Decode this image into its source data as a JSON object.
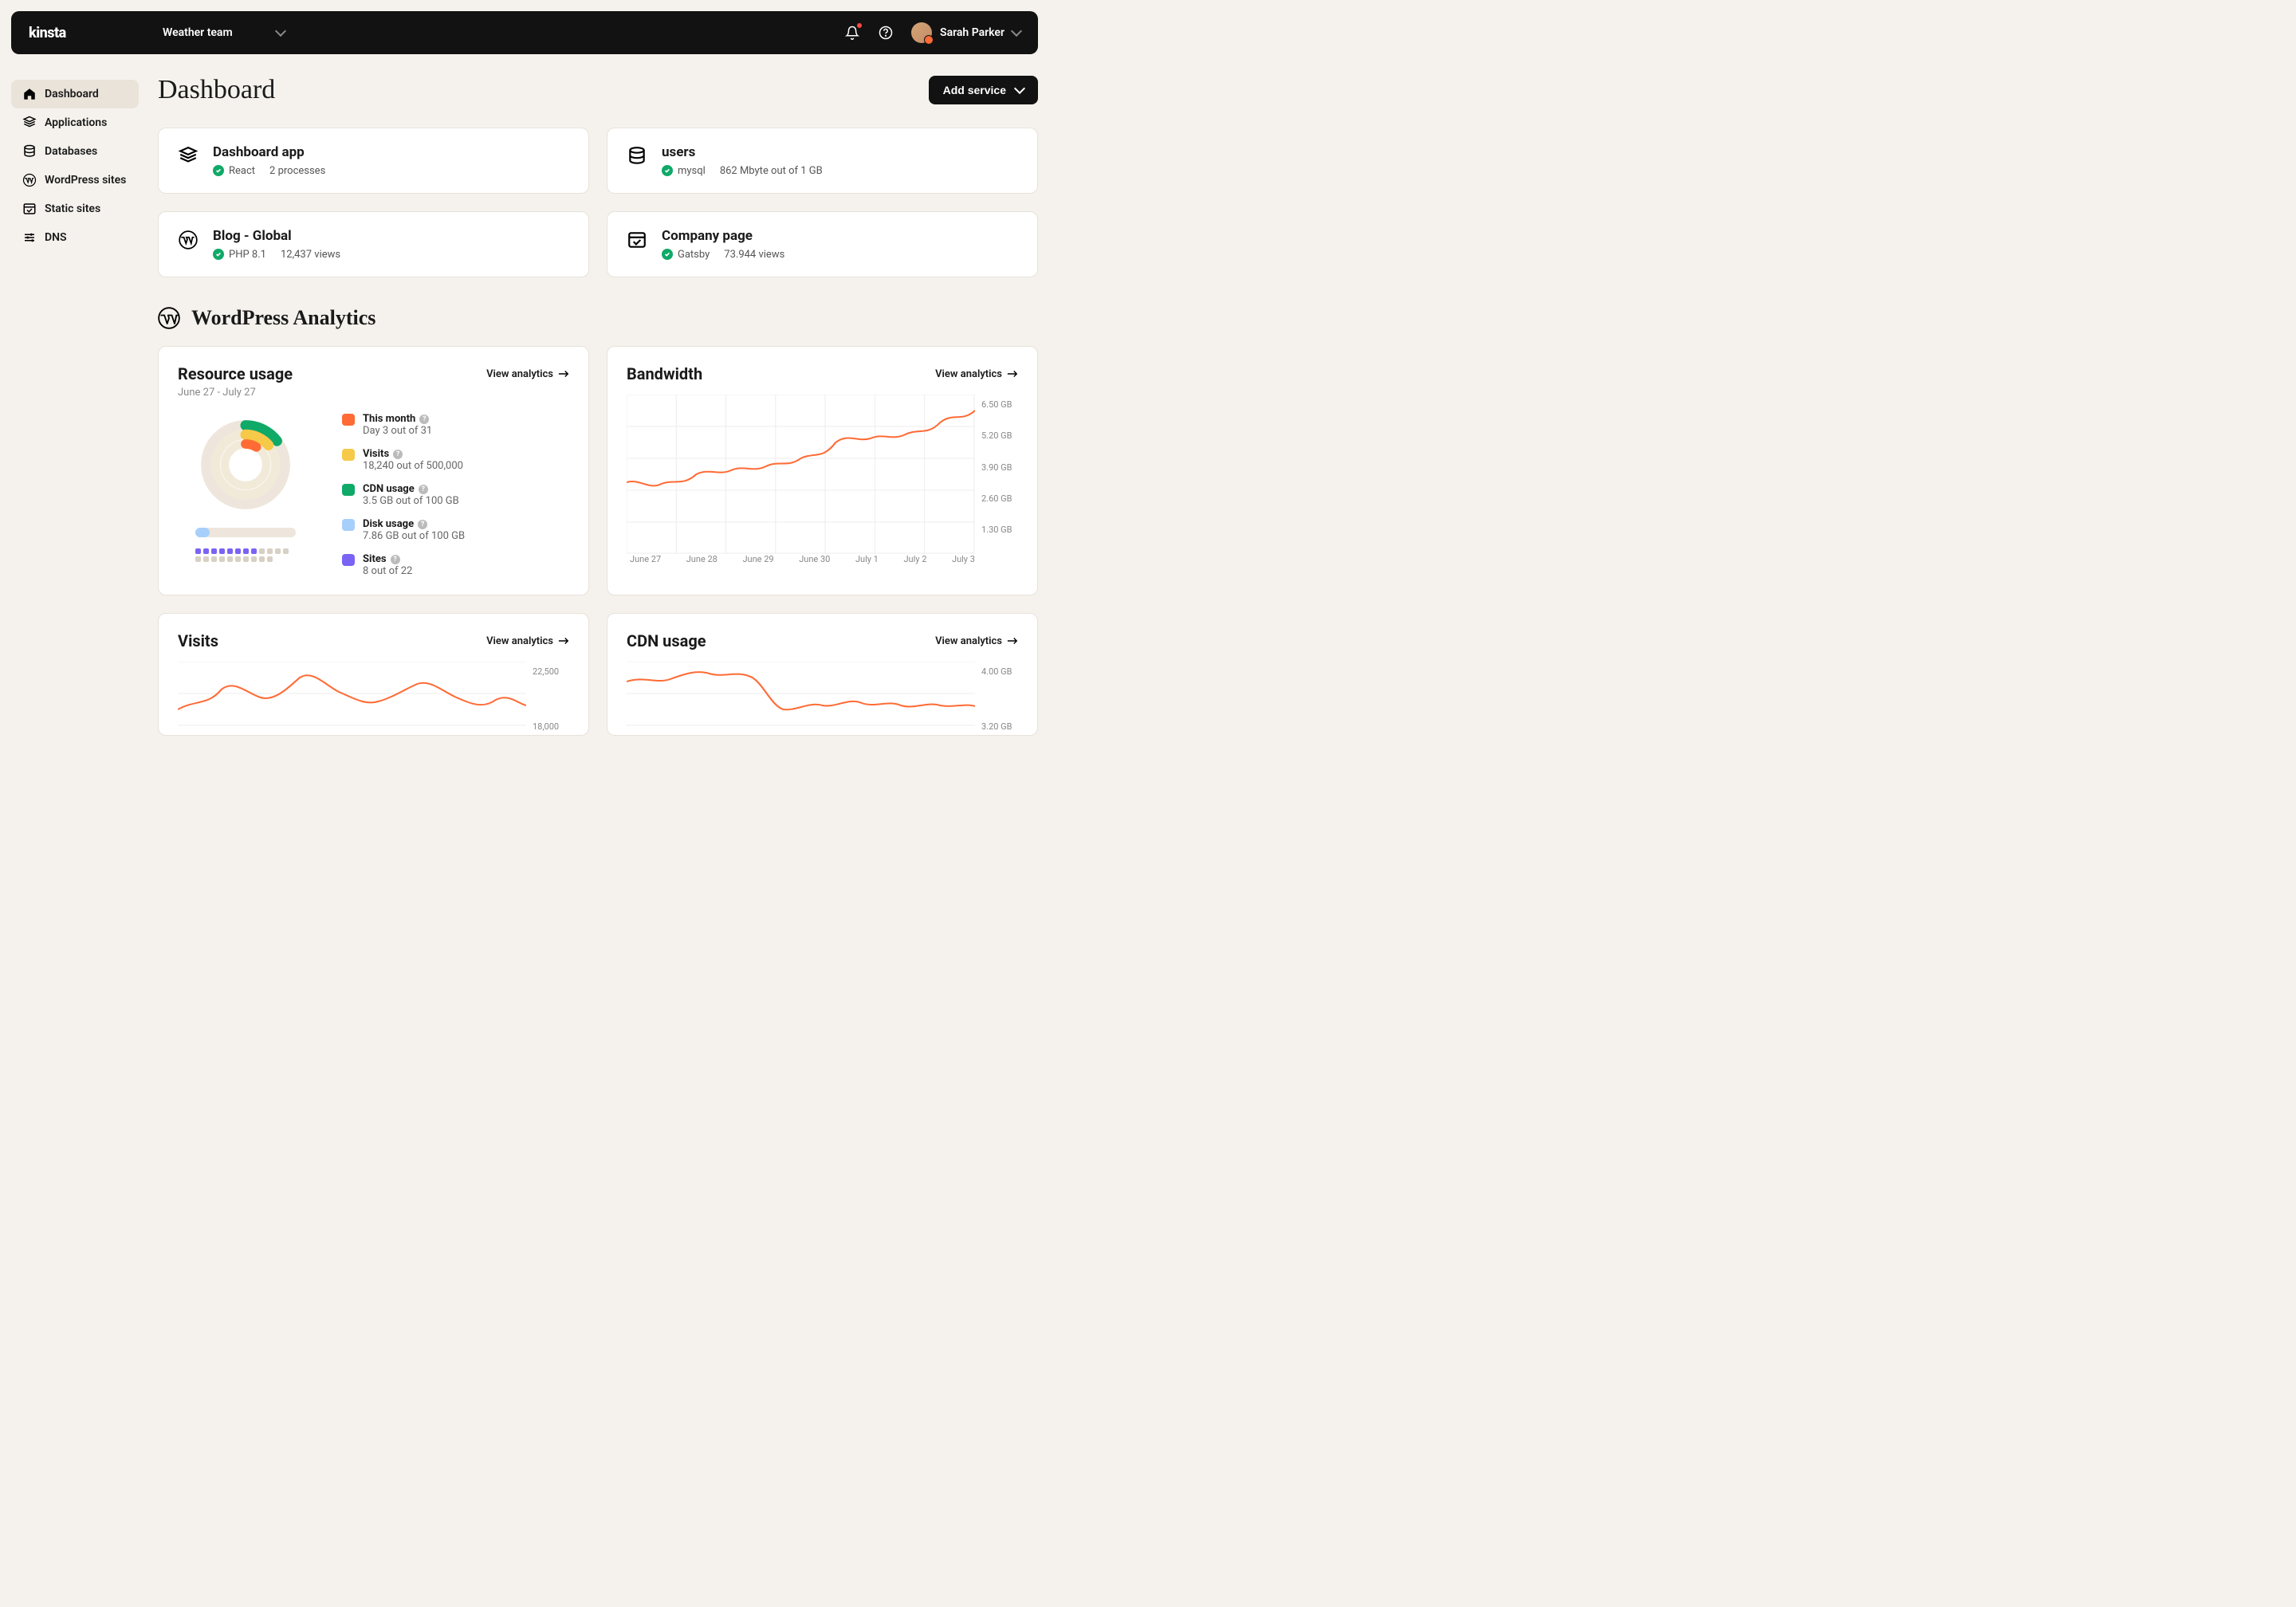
{
  "brand": "kinsta",
  "team_selector": "Weather team",
  "user": {
    "name": "Sarah Parker"
  },
  "sidebar": {
    "items": [
      {
        "id": "dashboard",
        "label": "Dashboard",
        "active": true,
        "icon": "home"
      },
      {
        "id": "applications",
        "label": "Applications",
        "icon": "stack"
      },
      {
        "id": "databases",
        "label": "Databases",
        "icon": "database"
      },
      {
        "id": "wordpress",
        "label": "WordPress sites",
        "icon": "wordpress"
      },
      {
        "id": "static",
        "label": "Static sites",
        "icon": "browser"
      },
      {
        "id": "dns",
        "label": "DNS",
        "icon": "sliders"
      }
    ]
  },
  "page_title": "Dashboard",
  "add_service_label": "Add service",
  "services": [
    {
      "name": "Dashboard app",
      "tech": "React",
      "meta": "2 processes",
      "icon": "stack"
    },
    {
      "name": "users",
      "tech": "mysql",
      "meta": "862 Mbyte out of 1 GB",
      "icon": "database"
    },
    {
      "name": "Blog - Global",
      "tech": "PHP 8.1",
      "meta": "12,437 views",
      "icon": "wordpress"
    },
    {
      "name": "Company page",
      "tech": "Gatsby",
      "meta": "73.944 views",
      "icon": "browser"
    }
  ],
  "analytics_section_title": "WordPress Analytics",
  "view_analytics_label": "View analytics",
  "resource_usage": {
    "title": "Resource usage",
    "date_range": "June 27 - July 27",
    "legend": [
      {
        "color": "#ff6b35",
        "label": "This month",
        "sub": "Day 3 out of 31"
      },
      {
        "color": "#f7c948",
        "label": "Visits",
        "sub": "18,240 out of 500,000"
      },
      {
        "color": "#0fa968",
        "label": "CDN usage",
        "sub": "3.5 GB out of 100 GB"
      },
      {
        "color": "#a7cffb",
        "label": "Disk usage",
        "sub": "7.86 GB out of 100 GB"
      },
      {
        "color": "#7a64f5",
        "label": "Sites",
        "sub": "8 out of 22"
      }
    ]
  },
  "bandwidth": {
    "title": "Bandwidth",
    "y_ticks": [
      "6.50 GB",
      "5.20 GB",
      "3.90 GB",
      "2.60 GB",
      "1.30 GB"
    ],
    "x_ticks": [
      "June 27",
      "June 28",
      "June 29",
      "June 30",
      "July 1",
      "July 2",
      "July 3"
    ]
  },
  "visits": {
    "title": "Visits",
    "y_ticks": [
      "22,500",
      "18,000"
    ]
  },
  "cdn": {
    "title": "CDN usage",
    "y_ticks": [
      "4.00 GB",
      "3.20 GB"
    ]
  },
  "chart_data": [
    {
      "type": "line",
      "title": "Bandwidth",
      "x": [
        "June 27",
        "June 28",
        "June 29",
        "June 30",
        "July 1",
        "July 2",
        "July 3"
      ],
      "series": [
        {
          "name": "Bandwidth",
          "values": [
            3.7,
            4.1,
            4.3,
            4.6,
            5.3,
            5.6,
            6.3
          ]
        }
      ],
      "ylabel": "GB",
      "ylim": [
        1.3,
        6.5
      ]
    },
    {
      "type": "line",
      "title": "Visits",
      "series": [
        {
          "name": "Visits",
          "values": [
            18500,
            21000,
            19000,
            22000,
            20500,
            19000,
            21000,
            18500,
            20000,
            19500
          ]
        }
      ],
      "ylim": [
        18000,
        22500
      ]
    },
    {
      "type": "line",
      "title": "CDN usage",
      "series": [
        {
          "name": "CDN",
          "values": [
            3.8,
            3.9,
            3.7,
            4.0,
            3.9,
            3.3,
            3.2,
            3.5,
            3.3,
            3.4
          ]
        }
      ],
      "ylabel": "GB",
      "ylim": [
        3.2,
        4.0
      ]
    },
    {
      "type": "donut",
      "title": "Resource usage",
      "series": [
        {
          "name": "This month",
          "fraction": 0.097
        },
        {
          "name": "Visits",
          "fraction": 0.036
        },
        {
          "name": "CDN usage",
          "fraction": 0.035
        },
        {
          "name": "Disk usage",
          "fraction": 0.079
        },
        {
          "name": "Sites",
          "fraction": 0.364
        }
      ]
    }
  ]
}
